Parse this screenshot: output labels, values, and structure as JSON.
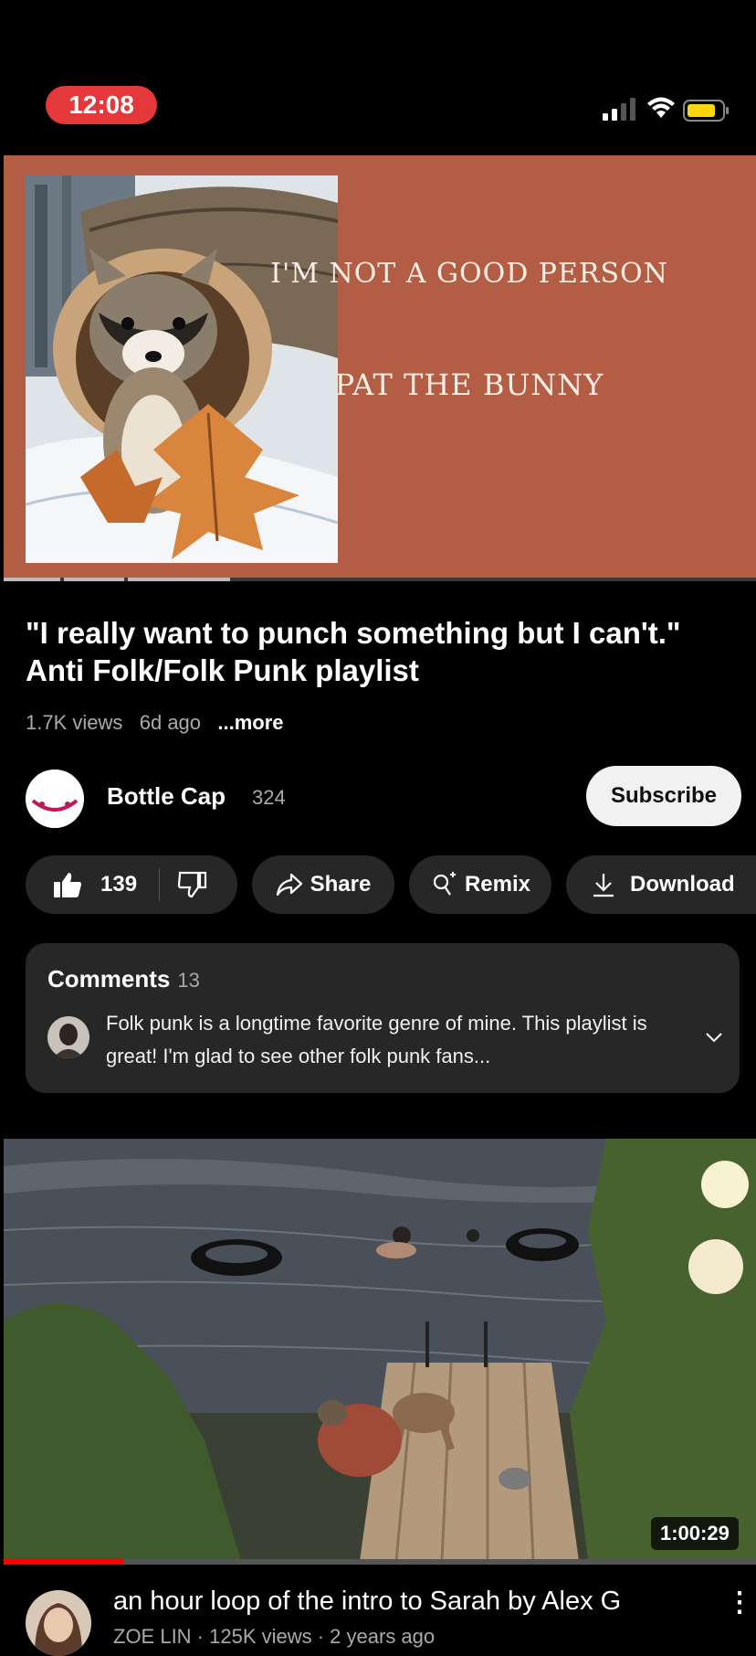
{
  "status_bar": {
    "time": "12:08"
  },
  "player": {
    "art_line_1": "I'M NOT A GOOD PERSON",
    "art_line_2": "PAT THE BUNNY"
  },
  "video": {
    "title": "\"I really want to punch something but I can't.\" Anti Folk/Folk Punk playlist",
    "views": "1.7K views",
    "age": "6d ago",
    "more_label": "...more"
  },
  "channel": {
    "name": "Bottle Cap",
    "subscribers": "324",
    "subscribe_label": "Subscribe"
  },
  "actions": {
    "like_count": "139",
    "share_label": "Share",
    "remix_label": "Remix",
    "download_label": "Download"
  },
  "comments": {
    "title": "Comments",
    "count": "13",
    "top_comment": "Folk punk is a longtime favorite genre of mine. This playlist is great! I'm glad to see other folk punk fans..."
  },
  "next_video": {
    "duration": "1:00:29",
    "title": "an hour loop of the intro to Sarah by Alex G",
    "subtitle": "ZOE LIN · 125K views · 2 years ago",
    "watch_progress": 0.16
  },
  "colors": {
    "player_bg": "#b45d45",
    "subscribe_bg": "#f1f1f1",
    "pill_bg": "#272727",
    "time_pill": "#e5383b",
    "progress_red": "#ff0000"
  }
}
